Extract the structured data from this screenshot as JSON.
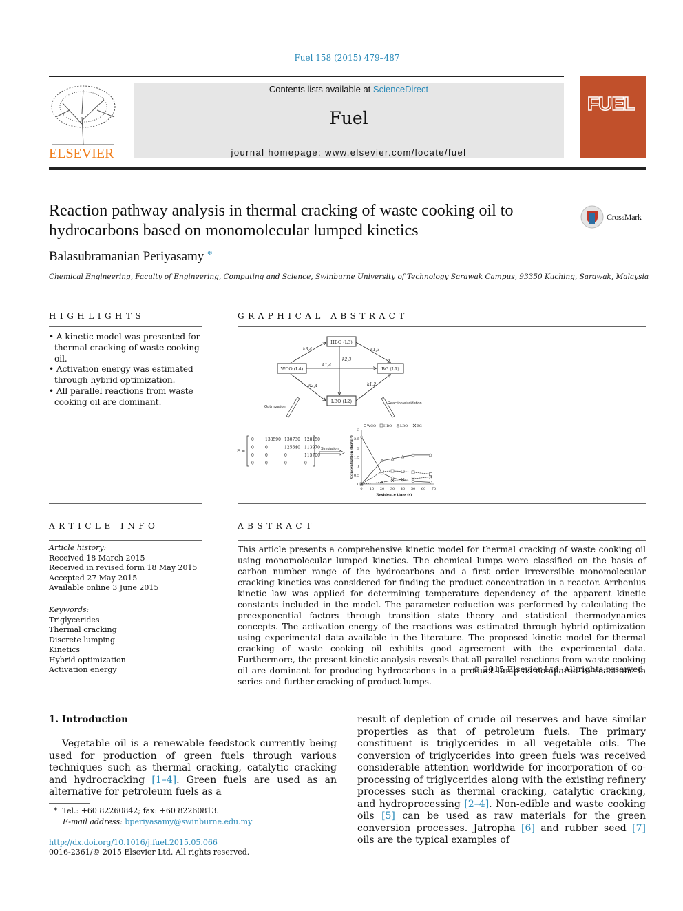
{
  "header": {
    "citation": "Fuel 158 (2015) 479–487",
    "contents_prefix": "Contents lists available at ",
    "contents_link": "ScienceDirect",
    "journal": "Fuel",
    "homepage": "journal homepage: www.elsevier.com/locate/fuel",
    "publisher_logo": "ELSEVIER",
    "cover_title": "FUEL"
  },
  "article": {
    "title": "Reaction pathway analysis in thermal cracking of waste cooking oil to hydrocarbons based on monomolecular lumped kinetics",
    "author": "Balasubramanian Periyasamy",
    "author_mark": "*",
    "crossmark": "CrossMark",
    "affiliation": "Chemical Engineering, Faculty of Engineering, Computing and Science, Swinburne University of Technology Sarawak Campus, 93350 Kuching, Sarawak, Malaysia"
  },
  "highlights": {
    "heading": "HIGHLIGHTS",
    "items": [
      "A kinetic model was presented for thermal cracking of waste cooking oil.",
      "Activation energy was estimated through hybrid optimization.",
      "All parallel reactions from waste cooking oil are dominant."
    ]
  },
  "graphical_abstract": {
    "heading": "GRAPHICAL ABSTRACT",
    "nodes": {
      "hbo": "HBO (L3)",
      "wco": "WCO (L4)",
      "bg": "BG (L1)",
      "lbo": "LBO (L2)"
    },
    "edges": {
      "k34": "k3,4",
      "k13": "k1,3",
      "k23": "k2,3",
      "k14": "k1,4",
      "k24": "k2,4",
      "k12": "k1,2"
    },
    "optimization": "Optimization",
    "reaction_elucidation": "Reaction elucidation",
    "simulation": "Simulation",
    "matrix_label": "E =",
    "matrix": [
      [
        "0",
        "138590",
        "130730",
        "128150"
      ],
      [
        "0",
        "0",
        "125640",
        "113970"
      ],
      [
        "0",
        "0",
        "0",
        "115700"
      ],
      [
        "0",
        "0",
        "0",
        "0"
      ]
    ],
    "chart_data": {
      "type": "line",
      "xlabel": "Residence time (s)",
      "ylabel": "Concentration (kg/m³)",
      "xlim": [
        0,
        70
      ],
      "ylim": [
        0,
        3
      ],
      "xticks": [
        "0",
        "10",
        "20",
        "30",
        "40",
        "50",
        "60",
        "70"
      ],
      "yticks": [
        "0",
        "0.5",
        "1",
        "1.5",
        "2",
        "2.5",
        "3"
      ],
      "legend": "top",
      "series": [
        {
          "name": "WCO",
          "marker": "diamond",
          "x": [
            0,
            20,
            30,
            40,
            50,
            67
          ],
          "y": [
            2.6,
            0.6,
            0.35,
            0.22,
            0.15,
            0.1
          ]
        },
        {
          "name": "HBO",
          "marker": "square",
          "x": [
            0,
            20,
            30,
            40,
            50,
            67
          ],
          "y": [
            0,
            0.7,
            0.72,
            0.7,
            0.65,
            0.55
          ]
        },
        {
          "name": "LBO",
          "marker": "triangle",
          "x": [
            0,
            20,
            30,
            40,
            50,
            67
          ],
          "y": [
            0,
            1.3,
            1.4,
            1.52,
            1.6,
            1.6
          ]
        },
        {
          "name": "BG",
          "marker": "star",
          "x": [
            0,
            20,
            30,
            40,
            50,
            67
          ],
          "y": [
            0,
            0.1,
            0.2,
            0.25,
            0.3,
            0.4
          ]
        }
      ]
    }
  },
  "article_info": {
    "heading": "ARTICLE INFO",
    "history_label": "Article history:",
    "history": [
      "Received 18 March 2015",
      "Received in revised form 18 May 2015",
      "Accepted 27 May 2015",
      "Available online 3 June 2015"
    ],
    "keywords_label": "Keywords:",
    "keywords": [
      "Triglycerides",
      "Thermal cracking",
      "Discrete lumping",
      "Kinetics",
      "Hybrid optimization",
      "Activation energy"
    ]
  },
  "abstract": {
    "heading": "ABSTRACT",
    "text": "This article presents a comprehensive kinetic model for thermal cracking of waste cooking oil using monomolecular lumped kinetics. The chemical lumps were classified on the basis of carbon number range of the hydrocarbons and a first order irreversible monomolecular cracking kinetics was considered for finding the product concentration in a reactor. Arrhenius kinetic law was applied for determining temperature dependency of the apparent kinetic constants included in the model. The parameter reduction was performed by calculating the preexponential factors through transition state theory and statistical thermodynamics concepts. The activation energy of the reactions was estimated through hybrid optimization using experimental data available in the literature. The proposed kinetic model for thermal cracking of waste cooking oil exhibits good agreement with the experimental data. Furthermore, the present kinetic analysis reveals that all parallel reactions from waste cooking oil are dominant for producing hydrocarbons in a product lump as compared to reactions in series and further cracking of product lumps.",
    "copyright": "© 2015 Elsevier Ltd. All rights reserved."
  },
  "intro": {
    "heading": "1. Introduction",
    "p1a": "Vegetable oil is a renewable feedstock currently being used for production of green fuels through various techniques such as thermal cracking, catalytic cracking and hydrocracking ",
    "ref1": "[1–4]",
    "p1b": ". Green fuels are used as an alternative for petroleum fuels as a",
    "c2a": "result of depletion of crude oil reserves and have similar properties as that of petroleum fuels. The primary constituent is triglycerides in all vegetable oils. The conversion of triglycerides into green fuels was received considerable attention worldwide for incorporation of co-processing of triglycerides along with the existing refinery processes such as thermal cracking, catalytic cracking, and hydroprocessing ",
    "ref2": "[2–4]",
    "c2b": ". Non-edible and waste cooking oils ",
    "ref3": "[5]",
    "c2c": " can be used as raw materials for the green conversion processes. Jatropha ",
    "ref4": "[6]",
    "c2d": " and rubber seed ",
    "ref5": "[7]",
    "c2e": " oils are the typical examples of"
  },
  "footnote": {
    "mark": "*",
    "tel": "Tel.: +60 82260842; fax: +60 82260813.",
    "email_label": "E-mail address: ",
    "email": "bperiyasamy@swinburne.edu.my",
    "doi": "http://dx.doi.org/10.1016/j.fuel.2015.05.066",
    "issn": "0016-2361/© 2015 Elsevier Ltd. All rights reserved."
  }
}
